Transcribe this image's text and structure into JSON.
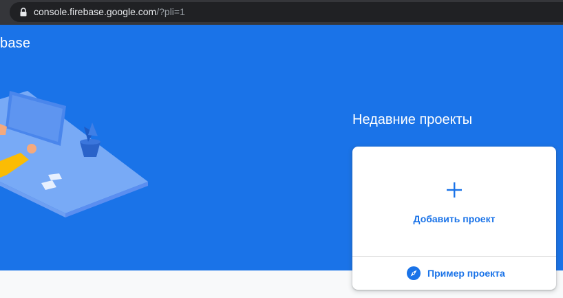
{
  "browser": {
    "url_host": "console.firebase.google.com",
    "url_path": "/?pli=1"
  },
  "header": {
    "brand": "base"
  },
  "recent": {
    "title": "Недавние проекты"
  },
  "card": {
    "add_label": "Добавить проект",
    "example_label": "Пример проекта"
  },
  "colors": {
    "hero_bg": "#1a73e8",
    "accent": "#1a73e8",
    "page_bg": "#f8f9fa"
  },
  "icons": {
    "lock": "lock-icon",
    "plus": "plus-icon",
    "compass": "compass-icon"
  }
}
